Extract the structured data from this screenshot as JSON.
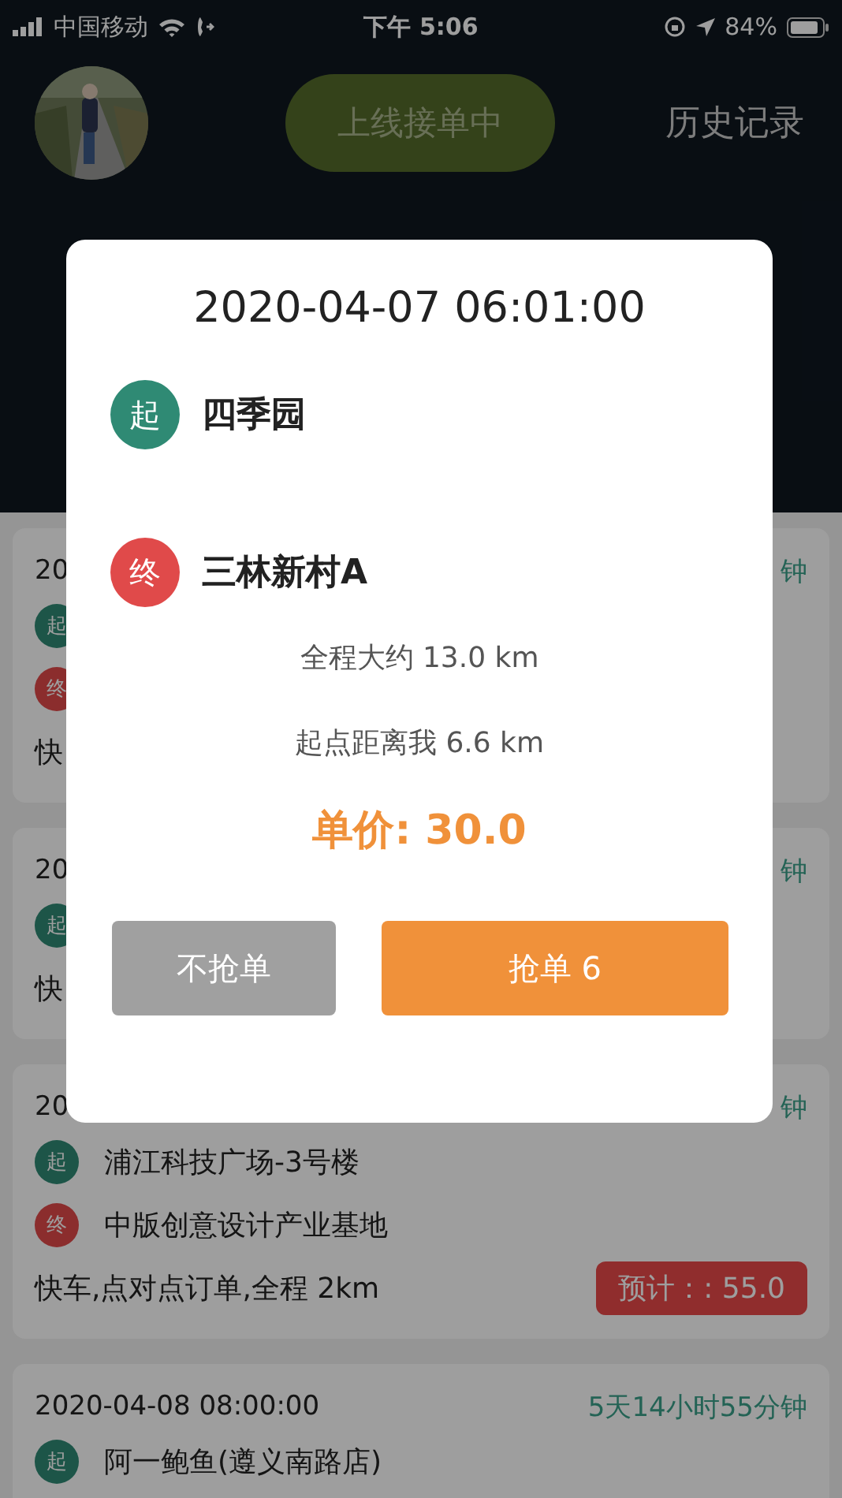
{
  "status_bar": {
    "carrier": "中国移动",
    "time": "下午 5:06",
    "battery": "84%"
  },
  "header": {
    "status_button": "上线接单中",
    "history_link": "历史记录"
  },
  "orders": [
    {
      "date": "20",
      "countdown": "钟",
      "stops": [
        {
          "kind": "start",
          "badge": "起"
        },
        {
          "kind": "end",
          "badge": "终"
        }
      ],
      "info": "快"
    },
    {
      "date": "20",
      "countdown": "钟",
      "stops": [
        {
          "kind": "start",
          "badge": "起"
        }
      ],
      "info": "快"
    },
    {
      "date": "20",
      "countdown": "钟",
      "stops": [
        {
          "kind": "start",
          "badge": "起",
          "name": "浦江科技广场-3号楼"
        },
        {
          "kind": "end",
          "badge": "终",
          "name": "中版创意设计产业基地"
        }
      ],
      "info": "快车,点对点订单,全程 2km",
      "price": "预计：: 55.0"
    },
    {
      "date": "2020-04-08 08:00:00",
      "countdown": "5天14小时55分钟",
      "stops": [
        {
          "kind": "start",
          "badge": "起",
          "name": "阿一鲍鱼(遵义南路店)"
        }
      ]
    }
  ],
  "modal": {
    "datetime": "2020-04-07 06:01:00",
    "stops": [
      {
        "kind": "start",
        "badge": "起",
        "name": "四季园"
      },
      {
        "kind": "end",
        "badge": "终",
        "name": "三林新村A"
      }
    ],
    "distance_total": "全程大约 13.0 km",
    "distance_to_me": "起点距离我 6.6 km",
    "price": "单价: 30.0",
    "buttons": [
      {
        "kind": "decline",
        "label": "不抢单"
      },
      {
        "kind": "accept",
        "label": "抢单 6"
      }
    ]
  }
}
